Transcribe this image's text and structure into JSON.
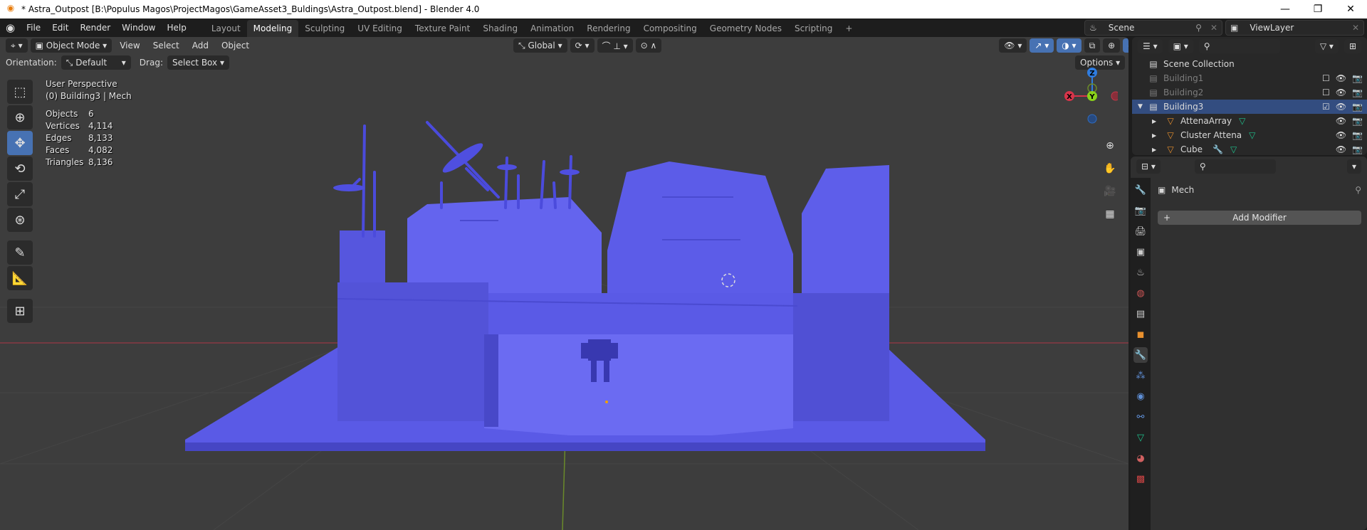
{
  "window": {
    "title": "* Astra_Outpost [B:\\Populus Magos\\ProjectMagos\\GameAsset3_Buldings\\Astra_Outpost.blend] - Blender 4.0",
    "controls": [
      "—",
      "❐",
      "✕"
    ]
  },
  "menu": [
    "File",
    "Edit",
    "Render",
    "Window",
    "Help"
  ],
  "workspaces": [
    {
      "label": "Layout"
    },
    {
      "label": "Modeling",
      "active": true
    },
    {
      "label": "Sculpting"
    },
    {
      "label": "UV Editing"
    },
    {
      "label": "Texture Paint"
    },
    {
      "label": "Shading"
    },
    {
      "label": "Animation"
    },
    {
      "label": "Rendering"
    },
    {
      "label": "Compositing"
    },
    {
      "label": "Geometry Nodes"
    },
    {
      "label": "Scripting"
    },
    {
      "label": "+"
    }
  ],
  "scene": "Scene",
  "view_layer": "ViewLayer",
  "viewport": {
    "mode": "Object Mode",
    "menus": [
      "View",
      "Select",
      "Add",
      "Object"
    ],
    "transform_orientation": "Global",
    "orientation_label": "Orientation:",
    "orientation": "Default",
    "drag_label": "Drag:",
    "drag": "Select Box",
    "options": "Options",
    "overlay_title": "User Perspective",
    "overlay_object": "(0) Building3 | Mech",
    "stats": [
      {
        "k": "Objects",
        "v": "6"
      },
      {
        "k": "Vertices",
        "v": "4,114"
      },
      {
        "k": "Edges",
        "v": "8,133"
      },
      {
        "k": "Faces",
        "v": "4,082"
      },
      {
        "k": "Triangles",
        "v": "8,136"
      }
    ],
    "gizmo": {
      "z": "Z",
      "y": "Y",
      "x": "X"
    },
    "colors": {
      "mesh": "#5b5be8",
      "mesh_dark": "#4a4ad0",
      "mesh_light": "#6c6cf0",
      "bg": "#3d3d3d"
    }
  },
  "outliner": {
    "root": "Scene Collection",
    "items": [
      {
        "name": "Building1",
        "dim": true,
        "checked": false
      },
      {
        "name": "Building2",
        "dim": true,
        "checked": false
      },
      {
        "name": "Building3",
        "selected": true,
        "checked": true
      },
      {
        "name": "AttenaArray",
        "child": true
      },
      {
        "name": "Cluster Attena",
        "child": true
      },
      {
        "name": "Cube",
        "child": true
      }
    ]
  },
  "properties": {
    "object": "Mech",
    "add_modifier": "Add Modifier"
  }
}
